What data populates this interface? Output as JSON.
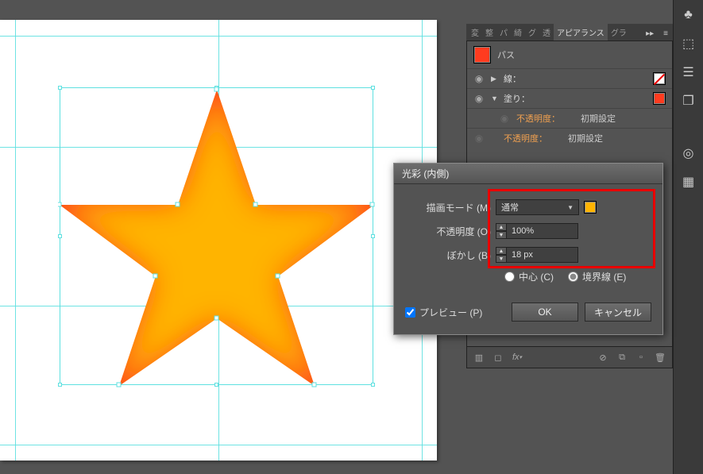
{
  "panel": {
    "tabs": [
      "変",
      "整",
      "パ",
      "綺",
      "グ",
      "透",
      "アピアランス",
      "グラ"
    ],
    "active_index": 6,
    "object_type": "パス",
    "rows": {
      "stroke_label": "線：",
      "fill_label": "塗り：",
      "opacity_label": "不透明度：",
      "opacity_value": "初期設定"
    }
  },
  "dialog": {
    "title": "光彩 (内側)",
    "blend_mode": {
      "label": "描画モード (M)",
      "value": "通常"
    },
    "opacity": {
      "label": "不透明度 (O)",
      "value": "100%"
    },
    "blur": {
      "label": "ぼかし (B)",
      "value": "18 px"
    },
    "radios": {
      "center": "中心 (C)",
      "edge": "境界線 (E)",
      "selected": "edge"
    },
    "preview_label": "プレビュー (P)",
    "ok_label": "OK",
    "cancel_label": "キャンセル",
    "glow_color": "#ffb400"
  },
  "footer_icons": [
    "layers-icon",
    "stroke-icon",
    "fx-icon",
    "clear-icon",
    "duplicate-icon",
    "new-icon",
    "trash-icon"
  ],
  "toolstrip_icons": [
    "club-icon",
    "marquee-icon",
    "bars-icon",
    "stack-icon",
    "circles-icon",
    "swatch-icon"
  ]
}
